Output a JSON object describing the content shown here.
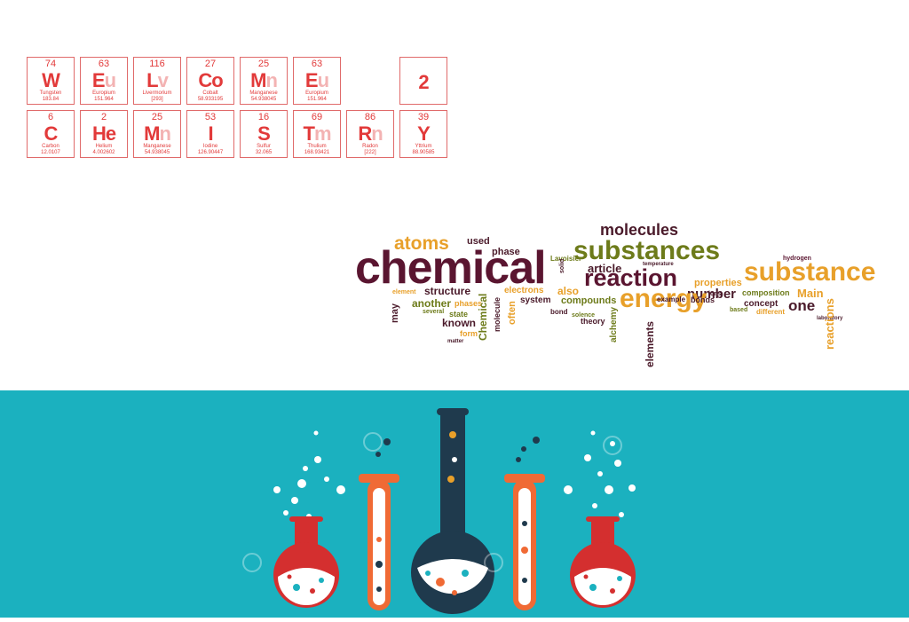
{
  "elements_row1": [
    {
      "num": "74",
      "sym": "W",
      "sym_faded": "",
      "name": "Tungsten",
      "weight": "183.84"
    },
    {
      "num": "63",
      "sym": "E",
      "sym_faded": "u",
      "name": "Europium",
      "weight": "151.964"
    },
    {
      "num": "116",
      "sym": "L",
      "sym_faded": "v",
      "name": "Livermorium",
      "weight": "[293]"
    },
    {
      "num": "27",
      "sym": "Co",
      "sym_faded": "",
      "name": "Cobalt",
      "weight": "58.933195"
    },
    {
      "num": "25",
      "sym": "M",
      "sym_faded": "n",
      "name": "Manganese",
      "weight": "54.938045"
    },
    {
      "num": "63",
      "sym": "E",
      "sym_faded": "u",
      "name": "Europium",
      "weight": "151.964"
    }
  ],
  "tile_2": {
    "sym": "2"
  },
  "elements_row2": [
    {
      "num": "6",
      "sym": "C",
      "sym_faded": "",
      "name": "Carbon",
      "weight": "12.0107"
    },
    {
      "num": "2",
      "sym": "He",
      "sym_faded": "",
      "name": "Helium",
      "weight": "4.002602"
    },
    {
      "num": "25",
      "sym": "M",
      "sym_faded": "n",
      "name": "Manganese",
      "weight": "54.938045"
    },
    {
      "num": "53",
      "sym": "I",
      "sym_faded": "",
      "name": "Iodine",
      "weight": "126.90447"
    },
    {
      "num": "16",
      "sym": "S",
      "sym_faded": "",
      "name": "Sulfur",
      "weight": "32.065"
    },
    {
      "num": "69",
      "sym": "T",
      "sym_faded": "m",
      "name": "Thulium",
      "weight": "168.93421"
    },
    {
      "num": "86",
      "sym": "R",
      "sym_faded": "n",
      "name": "Radon",
      "weight": "[222]"
    },
    {
      "num": "39",
      "sym": "Y",
      "sym_faded": "",
      "name": "Yttrium",
      "weight": "88.90585"
    }
  ],
  "word_cloud": {
    "chemical": "chemical",
    "molecules": "molecules",
    "substances": "substances",
    "substance": "substance",
    "atoms": "atoms",
    "reaction": "reaction",
    "energy": "energy",
    "number": "number",
    "properties": "properties",
    "article": "article",
    "structure": "structure",
    "electrons": "electrons",
    "compounds": "compounds",
    "phase": "phase",
    "used": "used",
    "another": "another",
    "known": "known",
    "system": "system",
    "also": "also",
    "theory": "theory",
    "bond": "bond",
    "elements": "elements",
    "composition": "composition",
    "concept": "concept",
    "different": "different",
    "one": "one",
    "Main": "Main",
    "reactions": "reactions",
    "hydrogen": "hydrogen",
    "bonds": "bonds",
    "example": "example",
    "ions": "ions",
    "based": "based",
    "state": "state",
    "form": "form",
    "matter": "matter",
    "may": "may",
    "element": "element",
    "phases": "phases",
    "molecule": "molecule",
    "often": "often",
    "Chemical": "Chemical",
    "solid": "solid",
    "solence": "solence",
    "alchemy": "alchemy",
    "Lavoisier": "Lavoisier",
    "temperature": "temperature",
    "several": "several",
    "laboratory": "laboratory"
  },
  "colors": {
    "cell_red": "#e23a3a",
    "teal_background": "#1bb1bf",
    "flask_red": "#d42f2f",
    "tube_orange": "#f06a35",
    "flask_navy": "#1f3a4d"
  }
}
